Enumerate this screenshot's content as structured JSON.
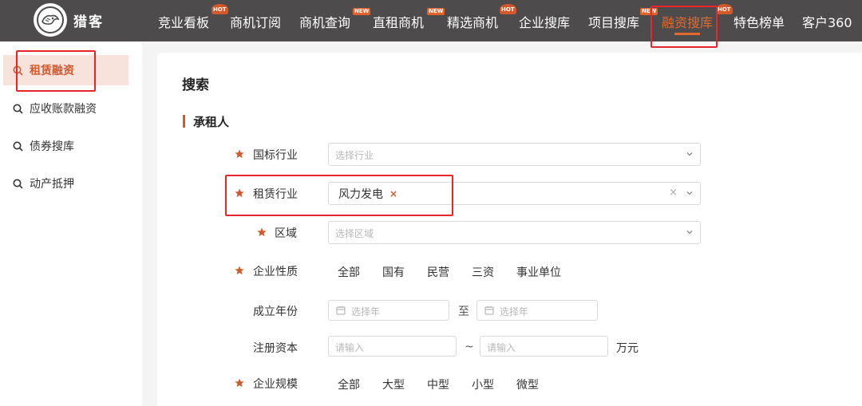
{
  "brand": {
    "name": "猎客"
  },
  "nav": {
    "items": [
      {
        "label": "竞业看板",
        "badge": "HOT"
      },
      {
        "label": "商机订阅",
        "badge": ""
      },
      {
        "label": "商机查询",
        "badge": "NEW"
      },
      {
        "label": "直租商机",
        "badge": "NEW"
      },
      {
        "label": "精选商机",
        "badge": "HOT"
      },
      {
        "label": "企业搜库",
        "badge": ""
      },
      {
        "label": "项目搜库",
        "badge": "NEW"
      },
      {
        "label": "融资搜库",
        "badge": "HOT",
        "active": true
      },
      {
        "label": "特色榜单",
        "badge": ""
      },
      {
        "label": "客户360",
        "badge": ""
      }
    ]
  },
  "sidebar": {
    "items": [
      {
        "label": "租赁融资",
        "active": true
      },
      {
        "label": "应收账款融资"
      },
      {
        "label": "债券搜库"
      },
      {
        "label": "动产抵押"
      }
    ]
  },
  "main": {
    "title": "搜索",
    "section": "承租人",
    "fields": {
      "industry_std": {
        "label": "国标行业",
        "placeholder": "选择行业"
      },
      "lease_industry": {
        "label": "租赁行业",
        "tag": "风力发电",
        "tag_remove": "×",
        "clear": "×"
      },
      "region": {
        "label": "区域",
        "placeholder": "选择区域"
      },
      "nature": {
        "label": "企业性质",
        "options": [
          "全部",
          "国有",
          "民营",
          "三资",
          "事业单位"
        ]
      },
      "founded": {
        "label": "成立年份",
        "from_placeholder": "选择年",
        "sep": "至",
        "to_placeholder": "选择年"
      },
      "capital": {
        "label": "注册资本",
        "from_placeholder": "请输入",
        "sep": "~",
        "to_placeholder": "请输入",
        "unit": "万元"
      },
      "scale": {
        "label": "企业规模",
        "options": [
          "全部",
          "大型",
          "中型",
          "小型",
          "微型"
        ]
      }
    }
  },
  "colors": {
    "accent": "#d05a30",
    "topbar": "#4d4b4c",
    "annotation": "#e8252b"
  }
}
